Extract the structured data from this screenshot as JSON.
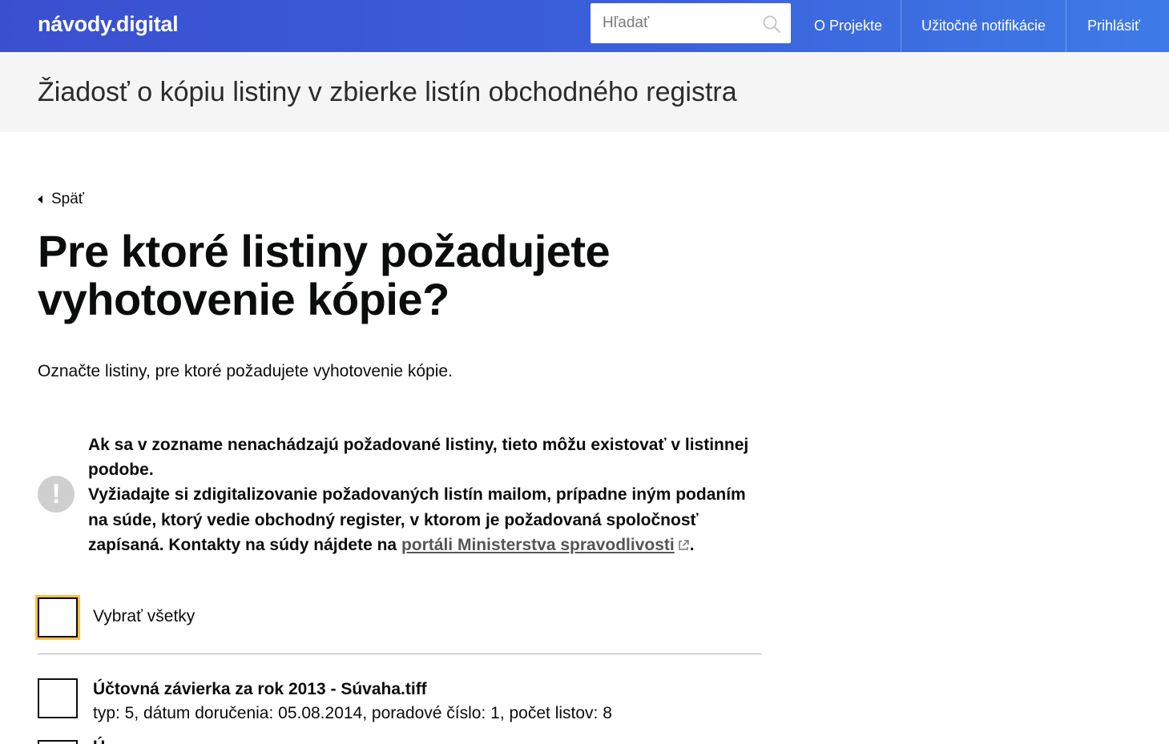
{
  "header": {
    "logo": "návody.digital",
    "search_placeholder": "Hľadať",
    "nav": [
      "O Projekte",
      "Užitočné notifikácie",
      "Prihlásiť"
    ]
  },
  "service_title": "Žiadosť o kópiu listiny v zbierke listín obchodného registra",
  "back_label": "Späť",
  "question": "Pre ktoré listiny požadujete vyhotovenie kópie?",
  "hint": "Označte listiny, pre ktoré požadujete vyhotovenie kópie.",
  "warning": {
    "text_part1": "Ak sa v zozname nenachádzajú požadované listiny, tieto môžu existovať v listinnej podobe.",
    "text_part2": "Vyžiadajte si zdigitalizovanie požadovaných listín mailom, prípadne iným podaním na súde, ktorý vedie obchodný register, v ktorom je požadovaná spoločnosť zapísaná. Kontakty na súdy nájdete na",
    "link_text": "portáli Ministerstva spravodlivosti",
    "text_end": "."
  },
  "select_all_label": "Vybrať všetky",
  "documents": [
    {
      "title": "Účtovná závierka za rok 2013 - Súvaha.tiff",
      "meta": "typ: 5, dátum doručenia: 05.08.2014, poradové číslo: 1, počet listov: 8"
    },
    {
      "title": "Ú"
    }
  ]
}
